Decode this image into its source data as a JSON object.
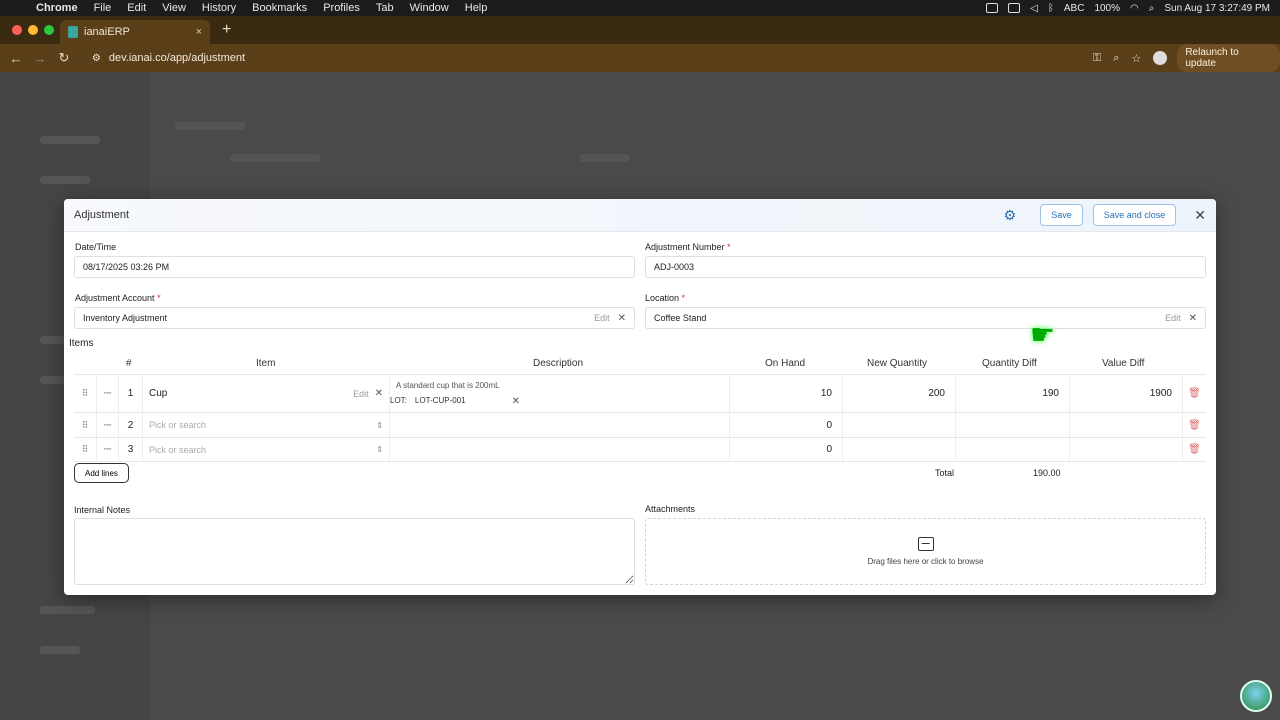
{
  "menubar": {
    "app": "Chrome",
    "items": [
      "File",
      "Edit",
      "View",
      "History",
      "Bookmarks",
      "Profiles",
      "Tab",
      "Window",
      "Help"
    ],
    "input_source": "ABC",
    "battery": "100%",
    "datetime": "Sun Aug 17  3:27:49 PM"
  },
  "browser": {
    "tab_title": "ianaiERP",
    "url": "dev.ianai.co/app/adjustment",
    "relaunch_label": "Relaunch to update"
  },
  "modal": {
    "title": "Adjustment",
    "save_label": "Save",
    "save_close_label": "Save and close",
    "datetime_label": "Date/Time",
    "datetime_value": "08/17/2025 03:26 PM",
    "adj_number_label": "Adjustment Number",
    "adj_number_value": "ADJ-0003",
    "account_label": "Adjustment Account",
    "account_value": "Inventory Adjustment",
    "location_label": "Location",
    "location_value": "Coffee Stand",
    "edit_label": "Edit",
    "items_label": "Items",
    "columns": {
      "num": "#",
      "item": "Item",
      "description": "Description",
      "on_hand": "On Hand",
      "new_qty": "New Quantity",
      "qty_diff": "Quantity Diff",
      "value_diff": "Value Diff"
    },
    "rows": [
      {
        "num": "1",
        "item": "Cup",
        "description": "A standard cup that is 200mL",
        "lot_label": "LOT:",
        "lot": "LOT-CUP-001",
        "on_hand": "10",
        "new_qty": "200",
        "qty_diff": "190",
        "value_diff": "1900"
      },
      {
        "num": "2",
        "placeholder": "Pick or search",
        "on_hand": "0"
      },
      {
        "num": "3",
        "placeholder": "Pick or search",
        "on_hand": "0"
      }
    ],
    "add_lines_label": "Add lines",
    "total_label": "Total",
    "total_value": "190.00",
    "notes_label": "Internal Notes",
    "attachments_label": "Attachments",
    "attach_hint": "Drag files here or click to browse"
  },
  "colors": {
    "accent": "#2a6fb5",
    "tabbar": "#3a2a12",
    "addressbar": "#5a3f18",
    "danger": "#e07070"
  }
}
